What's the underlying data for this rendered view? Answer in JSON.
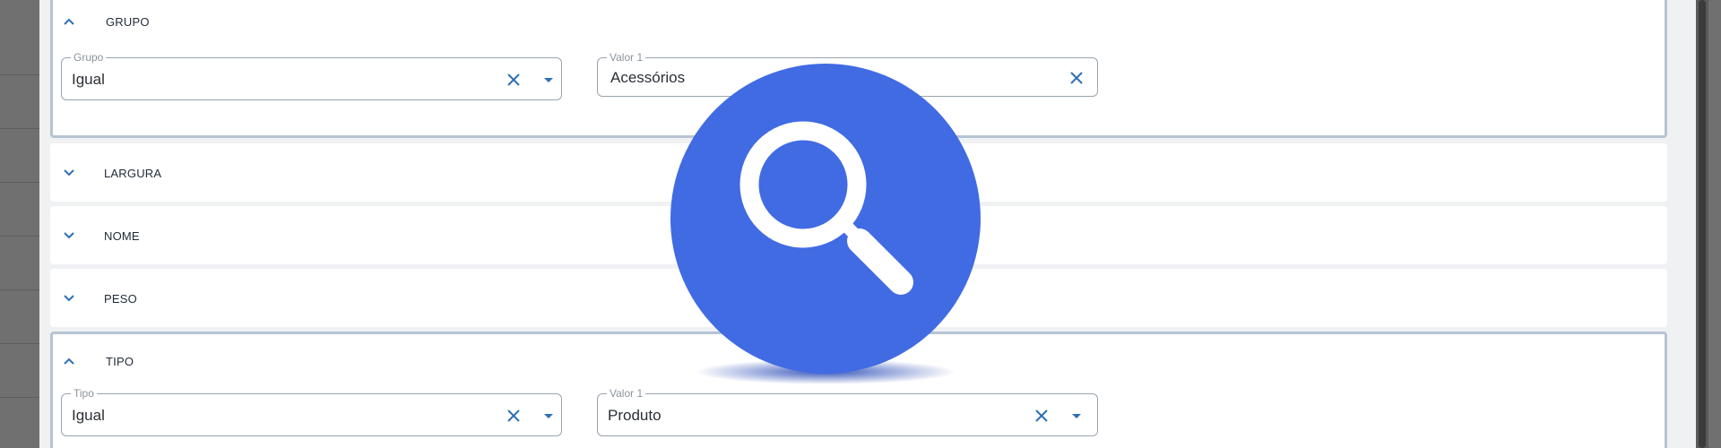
{
  "colors": {
    "accent": "#2f6fb5",
    "overlay_blue": "#416be2",
    "expanded_border": "#b7c3d3"
  },
  "sections": [
    {
      "title": "GRUPO",
      "expanded": true,
      "icon": "chevron-up-icon",
      "fields": [
        {
          "legend": "Grupo",
          "value": "Igual",
          "has_clear": true,
          "has_dropdown": true
        },
        {
          "legend": "Valor 1",
          "value": "Acessórios",
          "has_clear": true,
          "has_dropdown": false
        }
      ]
    },
    {
      "title": "LARGURA",
      "expanded": false,
      "icon": "chevron-down-icon"
    },
    {
      "title": "NOME",
      "expanded": false,
      "icon": "chevron-down-icon"
    },
    {
      "title": "PESO",
      "expanded": false,
      "icon": "chevron-down-icon"
    },
    {
      "title": "TIPO",
      "expanded": true,
      "icon": "chevron-up-icon",
      "fields": [
        {
          "legend": "Tipo",
          "value": "Igual",
          "has_clear": true,
          "has_dropdown": true
        },
        {
          "legend": "Valor 1",
          "value": "Produto",
          "has_clear": true,
          "has_dropdown": true
        }
      ]
    }
  ],
  "overlay": {
    "icon": "search-icon"
  }
}
